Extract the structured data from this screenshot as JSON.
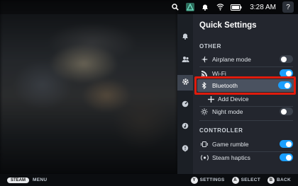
{
  "statusbar": {
    "time": "3:28 AM",
    "icons": [
      "search-icon",
      "steamdeck-icon",
      "notification-icon",
      "wifi-icon",
      "battery-icon"
    ],
    "help_label": "?"
  },
  "rail": {
    "items": [
      "notifications-icon",
      "friends-icon",
      "settings-icon",
      "performance-icon",
      "music-icon",
      "help-icon"
    ],
    "active_index": 2
  },
  "panel": {
    "title": "Quick Settings",
    "sections": {
      "other": {
        "heading": "OTHER",
        "airplane_label": "Airplane mode",
        "wifi_label": "Wi-Fi",
        "bluetooth_label": "Bluetooth",
        "add_device_label": "Add Device",
        "night_label": "Night mode"
      },
      "controller": {
        "heading": "CONTROLLER",
        "rumble_label": "Game rumble",
        "haptics_label": "Steam haptics"
      }
    },
    "toggles": {
      "airplane": false,
      "wifi": true,
      "bluetooth": true,
      "night": false,
      "rumble": true,
      "haptics": true
    }
  },
  "bottombar": {
    "steam_label": "STEAM",
    "menu_label": "MENU",
    "hints": [
      {
        "button": "Y",
        "label": "SETTINGS"
      },
      {
        "button": "A",
        "label": "SELECT"
      },
      {
        "button": "B",
        "label": "BACK"
      }
    ]
  },
  "colors": {
    "accent": "#1a9fff",
    "highlight_box": "#e01b0c",
    "panel_bg": "#23262e"
  }
}
